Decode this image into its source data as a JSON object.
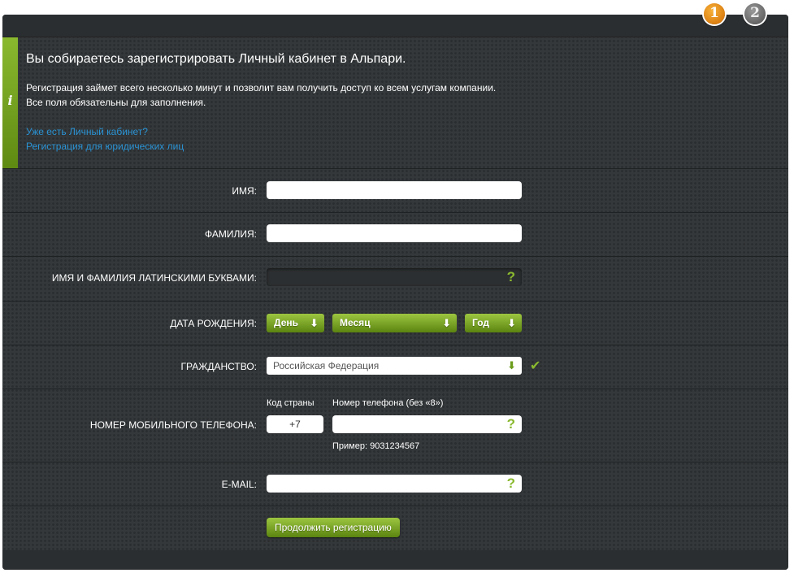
{
  "steps": {
    "step1": "1",
    "step2": "2"
  },
  "info": {
    "title": "Вы собираетесь зарегистрировать Личный кабинет в Альпари.",
    "text1": "Регистрация займет всего несколько минут и позволит вам получить доступ ко всем услугам компании.",
    "text2": "Все поля обязательны для заполнения.",
    "link_existing": "Уже есть Личный кабинет?",
    "link_legal": "Регистрация для юридических лиц",
    "icon": "i"
  },
  "form": {
    "first_name_label": "Имя:",
    "last_name_label": "Фамилия:",
    "latin_name_label": "Имя и фамилия латинскими буквами:",
    "help_mark": "?",
    "birth_label": "Дата рождения:",
    "day": "День",
    "month": "Месяц",
    "year": "Год",
    "arrow": "⬇",
    "citizenship_label": "Гражданство:",
    "citizenship_value": "Российская Федерация",
    "check": "✔",
    "phone_label": "Номер мобильного телефона:",
    "country_code_label": "Код страны",
    "phone_number_label": "Номер телефона (без «8»)",
    "country_code_value": "+7",
    "phone_example": "Пример: 9031234567",
    "email_label": "E-mail:",
    "submit": "Продолжить регистрацию"
  }
}
